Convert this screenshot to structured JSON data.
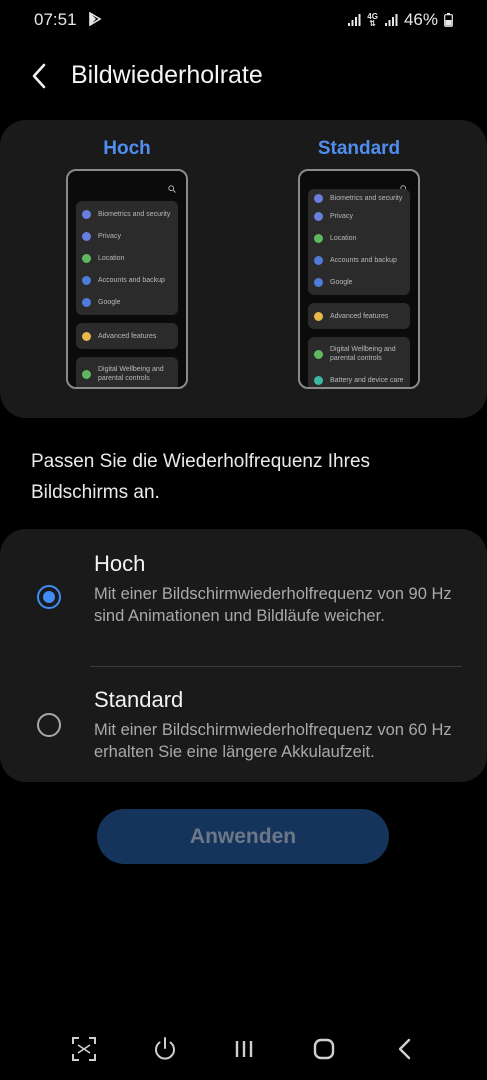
{
  "status_bar": {
    "time": "07:51",
    "network": "4G",
    "battery": "46%",
    "icons": [
      "play-store-icon",
      "signal-icon",
      "signal-icon",
      "battery-icon"
    ]
  },
  "header": {
    "title": "Bildwiederholrate",
    "back_icon": "chevron-left-icon"
  },
  "preview": {
    "left_label": "Hoch",
    "right_label": "Standard",
    "left_phone": {
      "group1": [
        "Biometrics and security",
        "Privacy",
        "Location",
        "Accounts and backup",
        "Google"
      ],
      "group2": [
        "Advanced features"
      ],
      "group3": [
        "Digital Wellbeing and parental controls"
      ]
    },
    "right_phone": {
      "group1": [
        "Biometrics and security",
        "Privacy",
        "Location",
        "Accounts and backup",
        "Google"
      ],
      "group2": [
        "Advanced features"
      ],
      "group3": [
        "Digital Wellbeing and parental controls",
        "Battery and device care"
      ]
    }
  },
  "description": "Passen Sie die Wiederholfrequenz Ihres Bildschirms an.",
  "options": [
    {
      "title": "Hoch",
      "description": "Mit einer Bildschirmwiederholfrequenz von 90 Hz sind Animationen und Bildläufe weicher.",
      "selected": true
    },
    {
      "title": "Standard",
      "description": "Mit einer Bildschirmwiederholfrequenz von 60 Hz erhalten Sie eine längere Akkulaufzeit.",
      "selected": false
    }
  ],
  "apply_button": "Anwenden",
  "navbar": [
    "screenshot-icon",
    "power-icon",
    "recents-icon",
    "home-icon",
    "back-icon"
  ],
  "colors": {
    "accent": "#3f8cf5",
    "preview_label": "#4f8ef0",
    "button_bg": "#15345b",
    "card_bg": "#1a1a1a"
  }
}
